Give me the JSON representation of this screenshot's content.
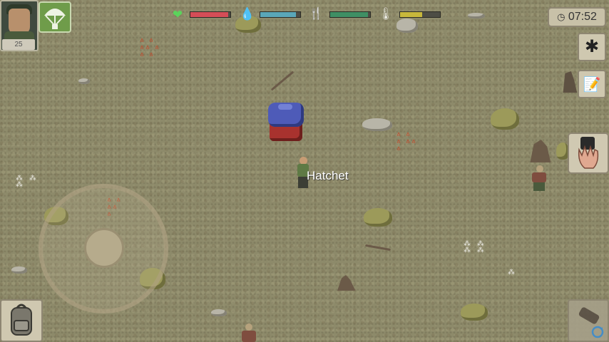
{
  "hud": {
    "player_level": "25",
    "time": "07:52",
    "stats": [
      {
        "name": "health",
        "icon": "heart-icon",
        "color": "#d54d57",
        "fill": 0.95
      },
      {
        "name": "thirst",
        "icon": "water-drop-icon",
        "color": "#5aa7b8",
        "fill": 0.9
      },
      {
        "name": "hunger",
        "icon": "fork-knife-icon",
        "color": "#3f8f64",
        "fill": 0.95
      },
      {
        "name": "temperature",
        "icon": "thermometer-icon",
        "color": "#c7b83c",
        "fill": 0.55
      }
    ]
  },
  "world": {
    "item_label": "Hatchet"
  },
  "buttons": {
    "settings_icon": "gear-icon",
    "journal_icon": "journal-icon",
    "grab_icon": "hand-grab-icon",
    "inventory_icon": "backpack-icon",
    "weapon_icon": "weapon-swap-icon",
    "parachute_icon": "parachute-icon"
  }
}
